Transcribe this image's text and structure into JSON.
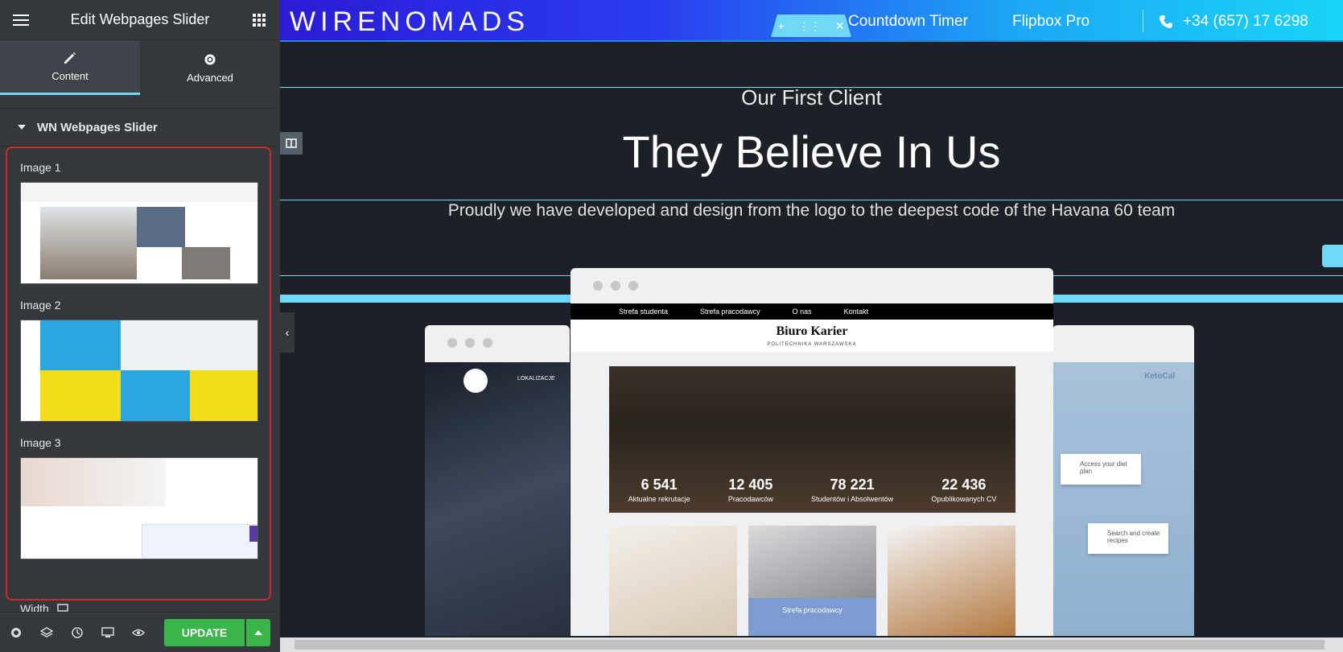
{
  "panel": {
    "title": "Edit Webpages Slider",
    "tabs": [
      {
        "label": "Content"
      },
      {
        "label": "Advanced"
      }
    ],
    "section_title": "WN Webpages Slider",
    "images": [
      {
        "label": "Image 1"
      },
      {
        "label": "Image 2"
      },
      {
        "label": "Image 3"
      }
    ],
    "width_label": "Width",
    "update_label": "UPDATE"
  },
  "canvas": {
    "logo": "WIRENOMADS",
    "nav": [
      "Countdown Timer",
      "Flipbox Pro"
    ],
    "phone": "+34 (657) 17 6298",
    "subtitle": "Our First Client",
    "headline": "They Believe In Us",
    "description": "Proudly we have developed and design from the logo to the deepest code of the Havana 60 team",
    "preview": {
      "site_nav": [
        "Strefa studenta",
        "Strefa pracodawcy",
        "O nas",
        "Kontakt"
      ],
      "brand": "Biuro Karier",
      "brand_sub": "POLITECHNIKA WARSZAWSKA",
      "stats": [
        {
          "num": "6 541",
          "label": "Aktualne rekrutacje"
        },
        {
          "num": "12 405",
          "label": "Pracodawców"
        },
        {
          "num": "78 221",
          "label": "Studentów i Absolwentów"
        },
        {
          "num": "22 436",
          "label": "Opublikowanych CV"
        }
      ],
      "card_label": "Strefa pracodawcy",
      "left_nav": "LOKALIZACJE",
      "right_bubble_1": "Access your diet plan",
      "right_bubble_2": "Search and create recipes",
      "right_brand": "KetoCal"
    }
  },
  "colors": {
    "accent": "#71d7f7",
    "update_green": "#39b54a",
    "highlight_red": "#d3272b"
  }
}
